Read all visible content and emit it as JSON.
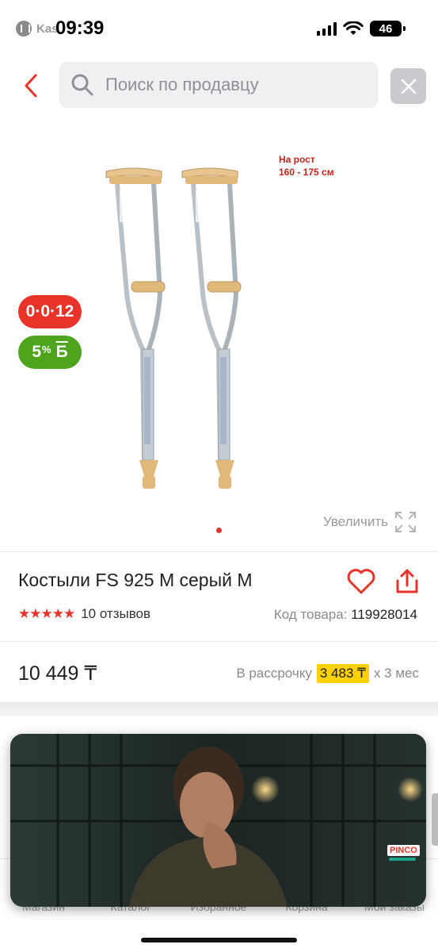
{
  "status_bar": {
    "app_name": "Kas",
    "time": "09:39",
    "battery": "46"
  },
  "search": {
    "placeholder": "Поиск по продавцу"
  },
  "gallery": {
    "height_note_line1": "На рост",
    "height_note_line2": "160 - 175 см",
    "badge_installment": "0·0·12",
    "badge_bonus_value": "5",
    "badge_bonus_percent": "%",
    "badge_bonus_currency": "Б",
    "zoom_label": "Увеличить"
  },
  "product": {
    "title": "Костыли FS 925 M серый M",
    "stars": "★★★★★",
    "reviews": "10 отзывов",
    "sku_label": "Код товара:",
    "sku_value": "119928014",
    "price": "10 449 ₸",
    "installment_label": "В рассрочку",
    "installment_amount": "3 483 ₸",
    "installment_term": "х 3 мес"
  },
  "ad": {
    "logo": "PINCO"
  },
  "bottom_nav": {
    "items": [
      "Магазин",
      "Каталог",
      "Избранное",
      "Корзина",
      "Мои заказы"
    ]
  },
  "colors": {
    "accent": "#e8332a",
    "bonus": "#4ea51d",
    "installment_highlight": "#ffd100"
  }
}
